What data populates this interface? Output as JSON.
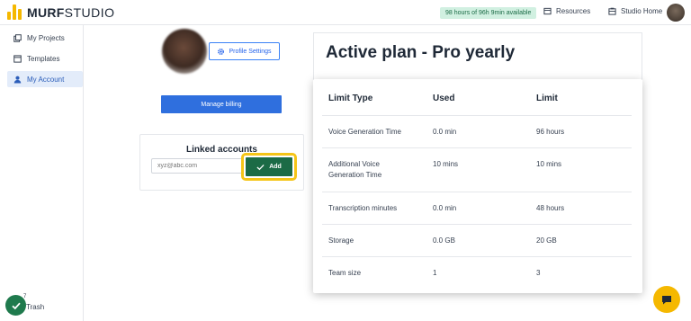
{
  "app": {
    "logo_main": "MURF",
    "logo_sub": "STUDIO"
  },
  "header": {
    "hours_available": "98 hours of 96h 9min available",
    "resources_label": "Resources",
    "studio_home_label": "Studio Home"
  },
  "sidebar": {
    "items": [
      {
        "label": "My Projects",
        "icon": "projects-icon"
      },
      {
        "label": "Templates",
        "icon": "templates-icon"
      },
      {
        "label": "My Account",
        "icon": "user-icon",
        "active": true
      }
    ],
    "trash_label": "Trash",
    "check_count": "7"
  },
  "profile": {
    "settings_label": "Profile Settings",
    "manage_billing_label": "Manage billing"
  },
  "linked_accounts": {
    "title": "Linked accounts",
    "email_placeholder": "xyz@abc.com",
    "add_label": "Add"
  },
  "plan": {
    "title": "Active plan - Pro yearly",
    "columns": [
      "Limit Type",
      "Used",
      "Limit"
    ],
    "rows": [
      {
        "type": "Voice Generation Time",
        "used": "0.0 min",
        "limit": "96 hours"
      },
      {
        "type": "Additional Voice Generation Time",
        "used": "10 mins",
        "limit": "10 mins"
      },
      {
        "type": "Transcription minutes",
        "used": "0.0 min",
        "limit": "48 hours"
      },
      {
        "type": "Storage",
        "used": "0.0 GB",
        "limit": "20 GB"
      },
      {
        "type": "Team size",
        "used": "1",
        "limit": "3"
      }
    ]
  },
  "colors": {
    "brand_yellow": "#f5b800",
    "primary_blue": "#2f6fde",
    "success_green": "#1b6b46",
    "highlight_yellow": "#f5c518"
  }
}
